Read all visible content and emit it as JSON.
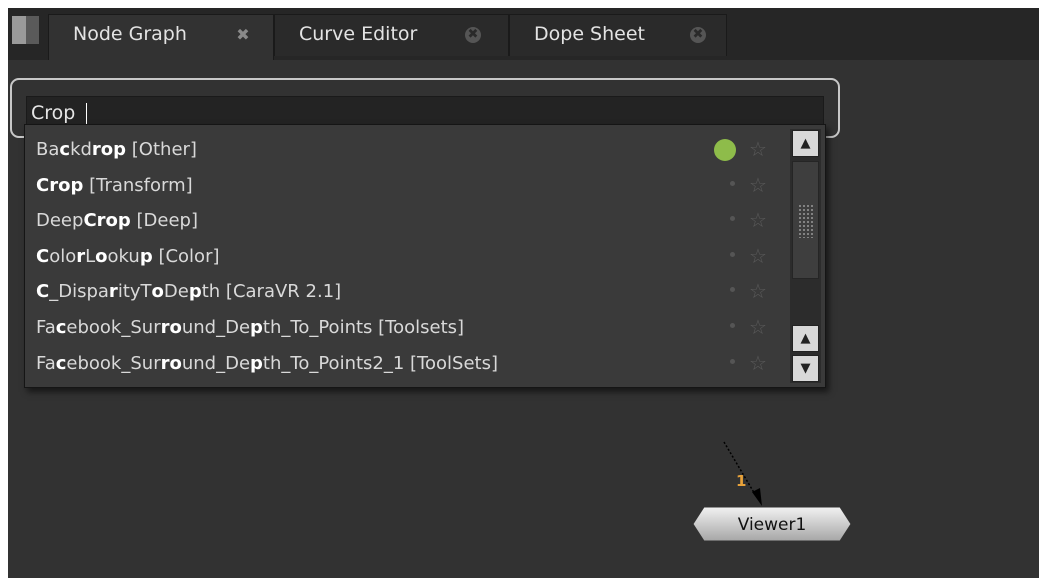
{
  "tabs": [
    {
      "label": "Node Graph",
      "active": true
    },
    {
      "label": "Curve Editor",
      "active": false
    },
    {
      "label": "Dope Sheet",
      "active": false
    }
  ],
  "search": {
    "value": "Crop"
  },
  "results": [
    {
      "parts": [
        [
          "Ba",
          false
        ],
        [
          "c",
          true
        ],
        [
          "kd",
          false
        ],
        [
          "rop",
          true
        ],
        [
          " [Other]",
          false
        ]
      ],
      "favorite": true
    },
    {
      "parts": [
        [
          "Crop",
          true
        ],
        [
          " [Transform]",
          false
        ]
      ],
      "favorite": false
    },
    {
      "parts": [
        [
          "Deep",
          false
        ],
        [
          "Crop",
          true
        ],
        [
          " [Deep]",
          false
        ]
      ],
      "favorite": false
    },
    {
      "parts": [
        [
          "C",
          true
        ],
        [
          "olo",
          false
        ],
        [
          "r",
          true
        ],
        [
          "L",
          false
        ],
        [
          "o",
          true
        ],
        [
          "oku",
          false
        ],
        [
          "p",
          true
        ],
        [
          " [Color]",
          false
        ]
      ],
      "favorite": false
    },
    {
      "parts": [
        [
          "C",
          true
        ],
        [
          "_Dispa",
          false
        ],
        [
          "r",
          true
        ],
        [
          "ityT",
          false
        ],
        [
          "o",
          true
        ],
        [
          "De",
          false
        ],
        [
          "p",
          true
        ],
        [
          "th [CaraVR 2.1]",
          false
        ]
      ],
      "favorite": false
    },
    {
      "parts": [
        [
          "Fa",
          false
        ],
        [
          "c",
          true
        ],
        [
          "ebook_Sur",
          false
        ],
        [
          "ro",
          true
        ],
        [
          "und_De",
          false
        ],
        [
          "p",
          true
        ],
        [
          "th_To_Points [Toolsets]",
          false
        ]
      ],
      "favorite": false
    },
    {
      "parts": [
        [
          "Fa",
          false
        ],
        [
          "c",
          true
        ],
        [
          "ebook_Sur",
          false
        ],
        [
          "ro",
          true
        ],
        [
          "und_De",
          false
        ],
        [
          "p",
          true
        ],
        [
          "th_To_Points2_1 [ToolSets]",
          false
        ]
      ],
      "favorite": false
    }
  ],
  "icons": {
    "favorite_star": "☆",
    "tab_close": "✖",
    "scroll_up": "▲",
    "scroll_down": "▼"
  },
  "colors": {
    "favorite_dot": "#8ebc4a",
    "pipe_number": "#e8a23a"
  },
  "node": {
    "label": "Viewer1",
    "input_number": "1"
  }
}
